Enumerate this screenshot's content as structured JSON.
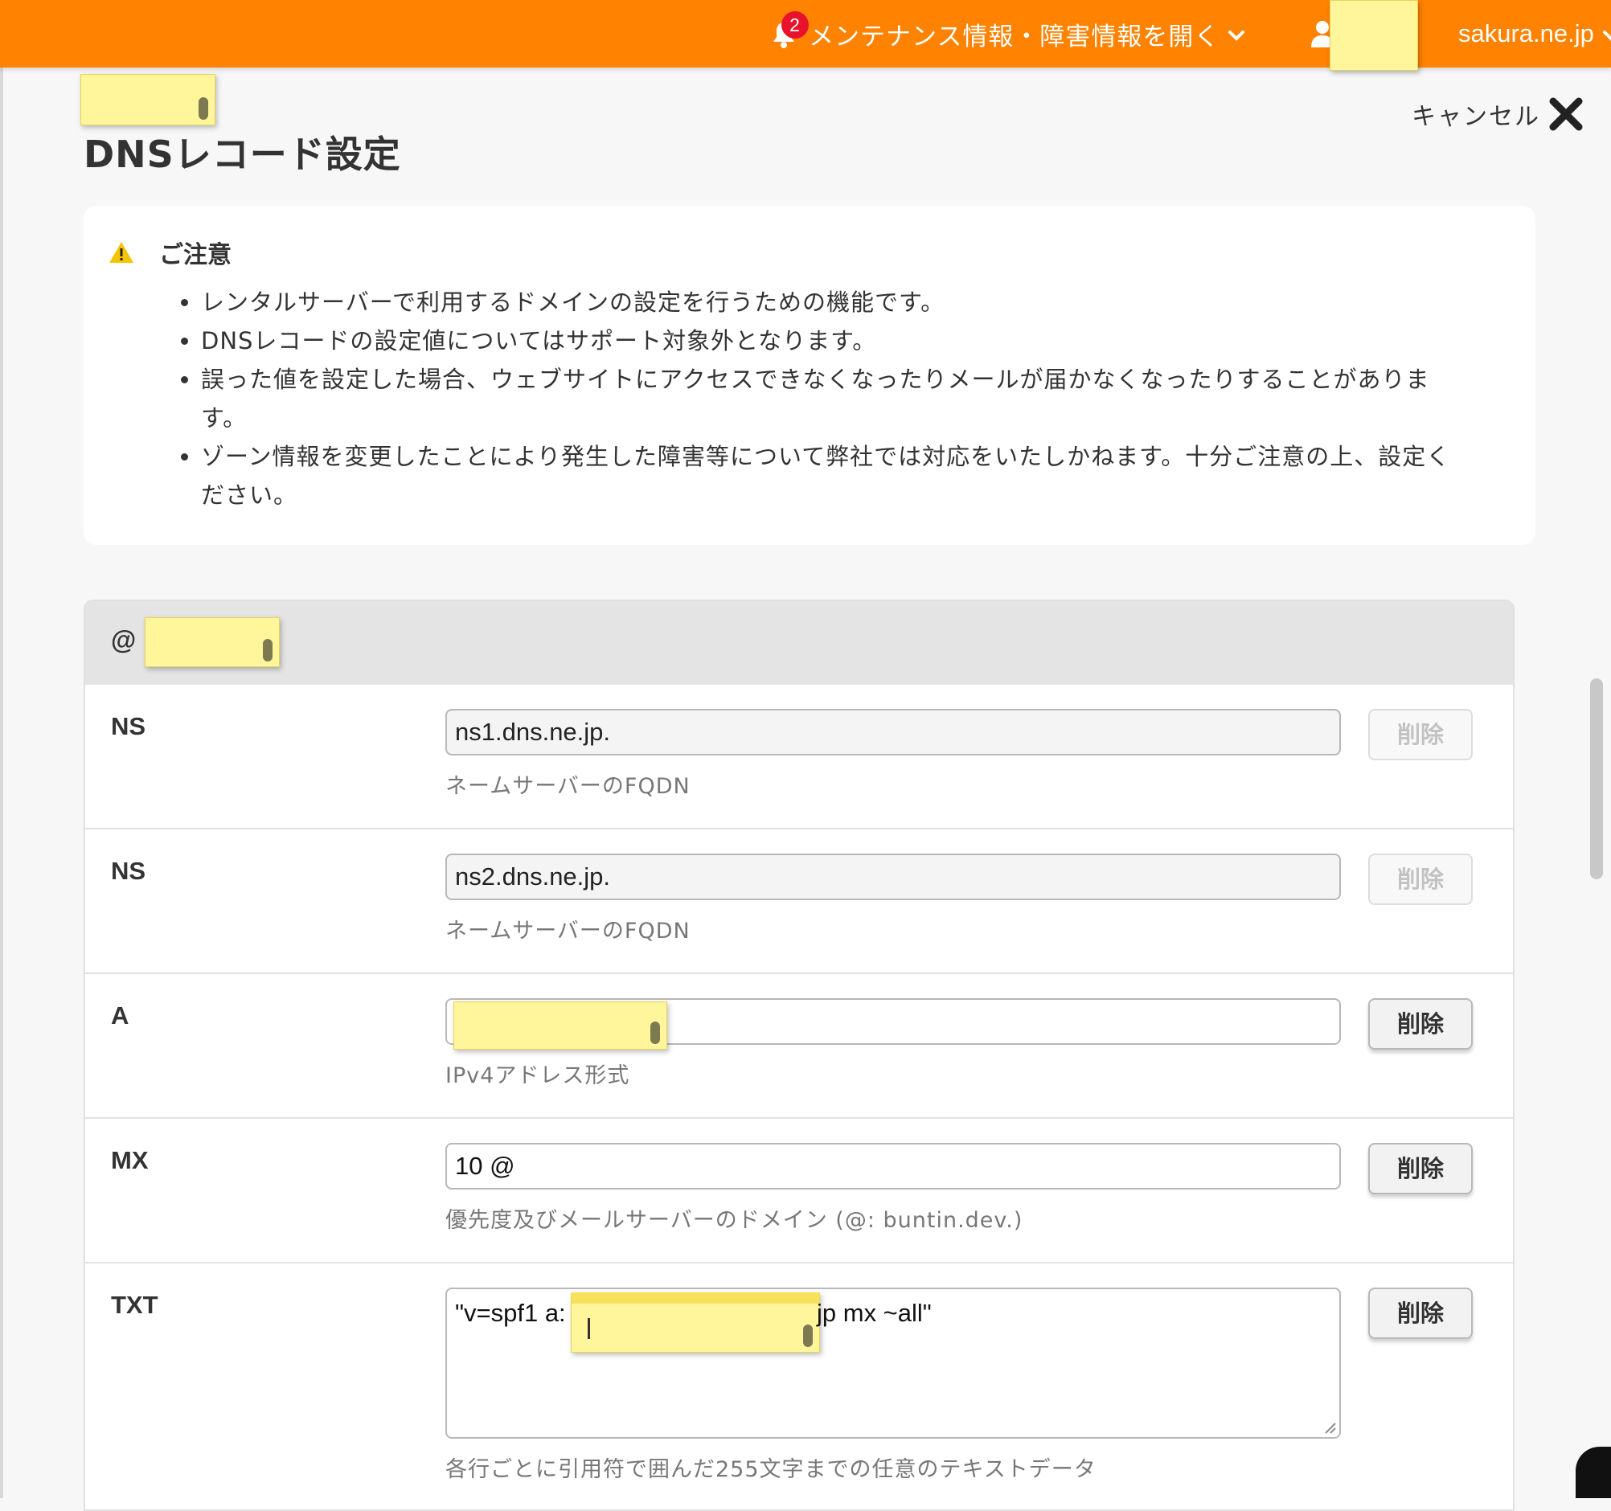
{
  "header": {
    "notification_count": "2",
    "maintenance_label": "メンテナンス情報・障害情報を開く",
    "account_suffix": "sakura.ne.jp",
    "brand_color": "#ff8200"
  },
  "page": {
    "title": "DNSレコード設定",
    "cancel_label": "キャンセル"
  },
  "notice": {
    "heading": "ご注意",
    "items": [
      "レンタルサーバーで利用するドメインの設定を行うための機能です。",
      "DNSレコードの設定値についてはサポート対象外となります。",
      "誤った値を設定した場合、ウェブサイトにアクセスできなくなったりメールが届かなくなったりすることがあります。",
      "ゾーン情報を変更したことにより発生した障害等について弊社では対応をいたしかねます。十分ご注意の上、設定ください。"
    ]
  },
  "records": {
    "group_prefix": "@",
    "delete_label": "削除",
    "rows": [
      {
        "type": "NS",
        "value": "ns1.dns.ne.jp.",
        "hint": "ネームサーバーのFQDN",
        "deletable": false
      },
      {
        "type": "NS",
        "value": "ns2.dns.ne.jp.",
        "hint": "ネームサーバーのFQDN",
        "deletable": false
      },
      {
        "type": "A",
        "value": "",
        "hint": "IPv4アドレス形式",
        "deletable": true
      },
      {
        "type": "MX",
        "value": "10 @",
        "hint": "優先度及びメールサーバーのドメイン (@: buntin.dev.)",
        "deletable": true
      },
      {
        "type": "TXT",
        "value_prefix": "\"v=spf1 a:",
        "value_suffix": "jp mx ~all\"",
        "hint": "各行ごとに引用符で囲んだ255文字までの任意のテキストデータ",
        "deletable": true
      }
    ]
  }
}
